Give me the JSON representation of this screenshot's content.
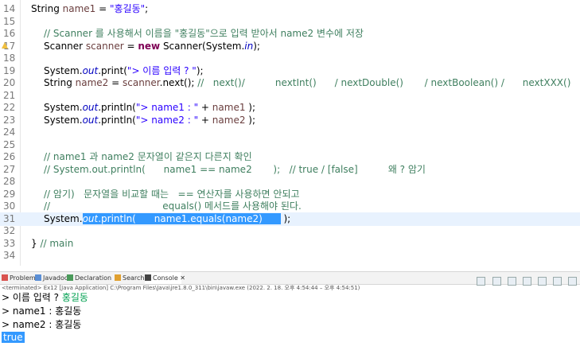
{
  "editor": {
    "lines": [
      {
        "n": "14",
        "parts": [
          {
            "t": "String ",
            "c": ""
          },
          {
            "t": "name1",
            "c": "var"
          },
          {
            "t": " = ",
            "c": ""
          },
          {
            "t": "\"홍길동\"",
            "c": "str"
          },
          {
            "t": ";",
            "c": ""
          }
        ]
      },
      {
        "n": "15",
        "parts": []
      },
      {
        "n": "16",
        "parts": [
          {
            "t": "// Scanner 를 사용해서 이름을 \"홍길동\"으로 입력 받아서 name2 변수에 저장",
            "c": "cm"
          }
        ]
      },
      {
        "n": "17",
        "parts": [
          {
            "t": "Scanner ",
            "c": ""
          },
          {
            "t": "scanner",
            "c": "var"
          },
          {
            "t": " = ",
            "c": ""
          },
          {
            "t": "new",
            "c": "kw"
          },
          {
            "t": " Scanner(System.",
            "c": ""
          },
          {
            "t": "in",
            "c": "fld"
          },
          {
            "t": ");",
            "c": ""
          }
        ]
      },
      {
        "n": "18",
        "parts": []
      },
      {
        "n": "19",
        "parts": [
          {
            "t": "System.",
            "c": ""
          },
          {
            "t": "out",
            "c": "fld"
          },
          {
            "t": ".print(",
            "c": ""
          },
          {
            "t": "\"> 이름 입력 ? \"",
            "c": "str"
          },
          {
            "t": ");",
            "c": ""
          }
        ]
      },
      {
        "n": "20",
        "parts": [
          {
            "t": "String ",
            "c": ""
          },
          {
            "t": "name2",
            "c": "var"
          },
          {
            "t": " = ",
            "c": ""
          },
          {
            "t": "scanner",
            "c": "var"
          },
          {
            "t": ".next(); ",
            "c": ""
          },
          {
            "t": "//   next()/          nextInt()      / nextDouble()       / nextBoolean() /      nextXXX()",
            "c": "cm"
          }
        ]
      },
      {
        "n": "21",
        "parts": []
      },
      {
        "n": "22",
        "parts": [
          {
            "t": "System.",
            "c": ""
          },
          {
            "t": "out",
            "c": "fld"
          },
          {
            "t": ".println(",
            "c": ""
          },
          {
            "t": "\"> name1 : \"",
            "c": "str"
          },
          {
            "t": " + ",
            "c": ""
          },
          {
            "t": "name1",
            "c": "var"
          },
          {
            "t": " );",
            "c": ""
          }
        ]
      },
      {
        "n": "23",
        "parts": [
          {
            "t": "System.",
            "c": ""
          },
          {
            "t": "out",
            "c": "fld"
          },
          {
            "t": ".println(",
            "c": ""
          },
          {
            "t": "\"> name2 : \"",
            "c": "str"
          },
          {
            "t": " + ",
            "c": ""
          },
          {
            "t": "name2",
            "c": "var"
          },
          {
            "t": " );",
            "c": ""
          }
        ]
      },
      {
        "n": "24",
        "parts": []
      },
      {
        "n": "25",
        "parts": []
      },
      {
        "n": "26",
        "parts": [
          {
            "t": "// name1 과 name2 문자열이 같은지 다른지 확인",
            "c": "cm"
          }
        ]
      },
      {
        "n": "27",
        "parts": [
          {
            "t": "// System.out.println(      name1 == name2       );   // true / [false]          왜 ? 암기",
            "c": "cm"
          }
        ]
      },
      {
        "n": "28",
        "parts": []
      },
      {
        "n": "29",
        "parts": [
          {
            "t": "// 암기)   문자열을 비교할 때는   == 연산자를 사용하면 안되고",
            "c": "cm"
          }
        ]
      },
      {
        "n": "30",
        "parts": [
          {
            "t": "//                                     equals() 메서드를 사용해야 된다.",
            "c": "cm"
          }
        ]
      },
      {
        "n": "31",
        "parts": [
          {
            "t": "System.",
            "c": ""
          },
          {
            "t": "out",
            "c": "fld sel"
          },
          {
            "t": ".println(      name1.equals(name2)      ",
            "c": "sel"
          },
          {
            "t": " );",
            "c": ""
          }
        ]
      },
      {
        "n": "32",
        "parts": []
      },
      {
        "n": "33",
        "parts": [
          {
            "t": "} ",
            "c": ""
          },
          {
            "t": "// main",
            "c": "cm"
          }
        ]
      },
      {
        "n": "34",
        "parts": []
      }
    ]
  },
  "views": {
    "tabs": [
      {
        "label": "Problems",
        "icon": "problems-icon"
      },
      {
        "label": "Javadoc",
        "icon": "javadoc-icon"
      },
      {
        "label": "Declaration",
        "icon": "declaration-icon"
      },
      {
        "label": "Search",
        "icon": "search-icon"
      },
      {
        "label": "Console",
        "icon": "console-icon",
        "active": true
      }
    ],
    "close_mark": "✕"
  },
  "console": {
    "terminated": "<terminated> Ex12 [Java Application] C:\\Program Files\\Java\\jre1.8.0_311\\bin\\javaw.exe  (2022. 2. 18. 오후 4:54:44 – 오후 4:54:51)",
    "prompt": "> 이름 입력 ? ",
    "input": "홍길동",
    "out1": "> name1 : 홍길동",
    "out2": "> name2 : 홍길동",
    "out3": "true"
  },
  "colors": {
    "selection": "#3399ff",
    "current_line": "#e8f2fe",
    "keyword": "#7f0055",
    "string": "#2a00ff",
    "comment": "#3f7f5f",
    "field": "#0000c0"
  }
}
